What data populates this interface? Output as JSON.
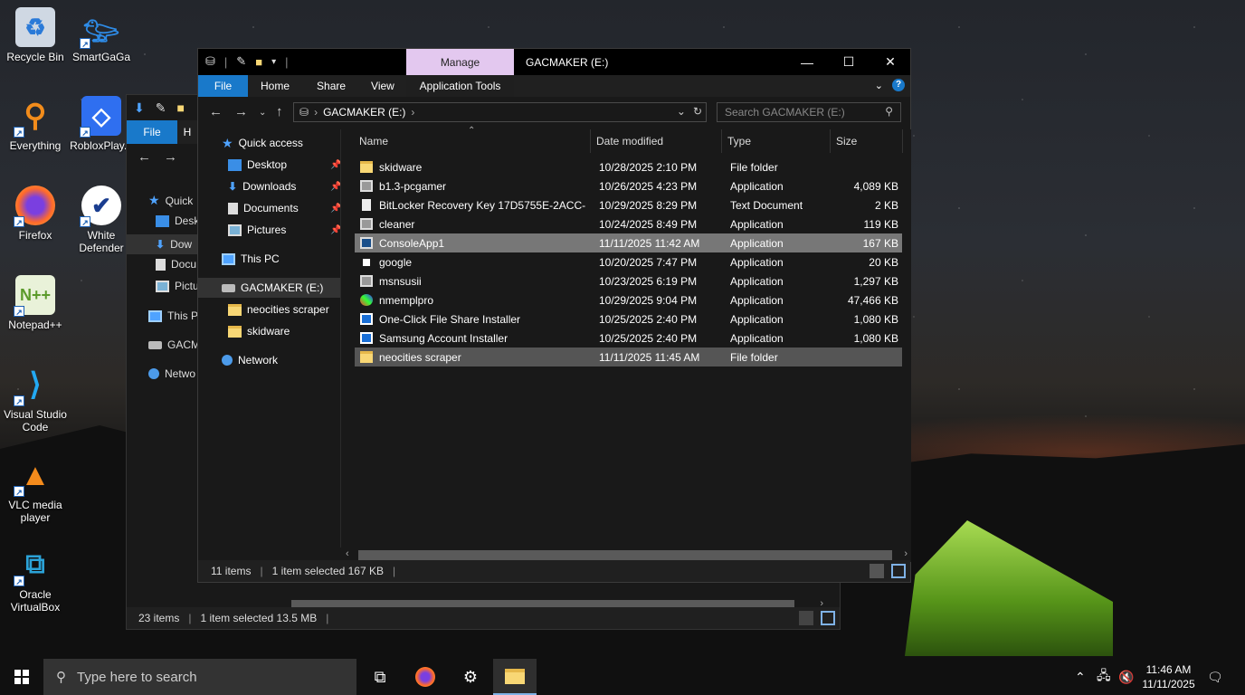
{
  "desktop": {
    "icons": [
      {
        "label": "Recycle Bin"
      },
      {
        "label": "SmartGaGa"
      },
      {
        "label": "Everything"
      },
      {
        "label": "RobloxPlay..."
      },
      {
        "label": "Firefox"
      },
      {
        "label": "White Defender"
      },
      {
        "label": "Notepad++"
      },
      {
        "label": "Visual Studio Code"
      },
      {
        "label": "VLC media player"
      },
      {
        "label": "Oracle VirtualBox"
      }
    ]
  },
  "back_window": {
    "file_tab": "File",
    "home_tab_partial": "H",
    "nav": {
      "quick": "Quick",
      "desk": "Desk",
      "down": "Dow",
      "docu": "Docu",
      "pict": "Pictu",
      "thispc": "This P",
      "gacm": "GACM",
      "netw": "Netwo"
    },
    "status_items": "23 items",
    "status_selected": "1 item selected  13.5 MB"
  },
  "window": {
    "contextual_tab": "Manage",
    "title": "GACMAKER (E:)",
    "ribbon": {
      "file": "File",
      "home": "Home",
      "share": "Share",
      "view": "View",
      "app_tools": "Application Tools"
    },
    "address": {
      "location": "GACMAKER (E:)",
      "search_placeholder": "Search GACMAKER (E:)"
    },
    "nav": {
      "quick_access": "Quick access",
      "desktop": "Desktop",
      "downloads": "Downloads",
      "documents": "Documents",
      "pictures": "Pictures",
      "this_pc": "This PC",
      "gacmaker": "GACMAKER (E:)",
      "neocities": "neocities scraper",
      "skidware": "skidware",
      "network": "Network"
    },
    "columns": {
      "name": "Name",
      "date": "Date modified",
      "type": "Type",
      "size": "Size"
    },
    "files": [
      {
        "name": "skidware",
        "date": "10/28/2025 2:10 PM",
        "type": "File folder",
        "size": ""
      },
      {
        "name": "b1.3-pcgamer",
        "date": "10/26/2025 4:23 PM",
        "type": "Application",
        "size": "4,089 KB"
      },
      {
        "name": "BitLocker Recovery Key 17D5755E-2ACC-...",
        "date": "10/29/2025 8:29 PM",
        "type": "Text Document",
        "size": "2 KB"
      },
      {
        "name": "cleaner",
        "date": "10/24/2025 8:49 PM",
        "type": "Application",
        "size": "119 KB"
      },
      {
        "name": "ConsoleApp1",
        "date": "11/11/2025 11:42 AM",
        "type": "Application",
        "size": "167 KB"
      },
      {
        "name": "google",
        "date": "10/20/2025 7:47 PM",
        "type": "Application",
        "size": "20 KB"
      },
      {
        "name": "msnsusii",
        "date": "10/23/2025 6:19 PM",
        "type": "Application",
        "size": "1,297 KB"
      },
      {
        "name": "nmemplpro",
        "date": "10/29/2025 9:04 PM",
        "type": "Application",
        "size": "47,466 KB"
      },
      {
        "name": "One-Click File Share Installer",
        "date": "10/25/2025 2:40 PM",
        "type": "Application",
        "size": "1,080 KB"
      },
      {
        "name": "Samsung Account Installer",
        "date": "10/25/2025 2:40 PM",
        "type": "Application",
        "size": "1,080 KB"
      },
      {
        "name": "neocities scraper",
        "date": "11/11/2025 11:45 AM",
        "type": "File folder",
        "size": ""
      }
    ],
    "status": {
      "items": "11 items",
      "selected": "1 item selected  167 KB"
    }
  },
  "taskbar": {
    "search_placeholder": "Type here to search",
    "time": "11:46 AM",
    "date": "11/11/2025"
  }
}
